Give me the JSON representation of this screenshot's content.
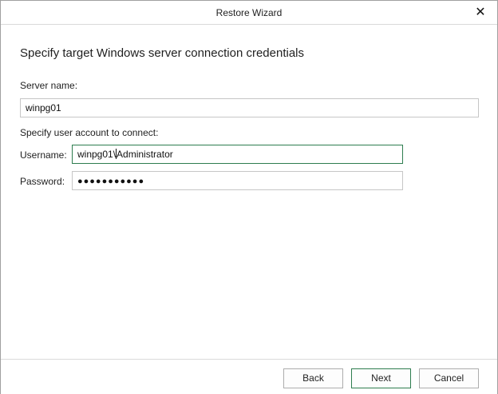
{
  "window": {
    "title": "Restore Wizard",
    "close_glyph": "✕"
  },
  "page": {
    "heading": "Specify target Windows server connection credentials"
  },
  "server": {
    "label": "Server name:",
    "value": "winpg01"
  },
  "account": {
    "section_label": "Specify user account to connect:",
    "username_label": "Username:",
    "username_before_caret": "winpg01\\",
    "username_after_caret": "Administrator",
    "password_label": "Password:",
    "password_mask": "●●●●●●●●●●●"
  },
  "buttons": {
    "back": "Back",
    "next": "Next",
    "cancel": "Cancel"
  },
  "colors": {
    "focus_border": "#2e7d4f",
    "default_button_border": "#2e7d4f"
  },
  "icons": {
    "close": "close-icon"
  }
}
